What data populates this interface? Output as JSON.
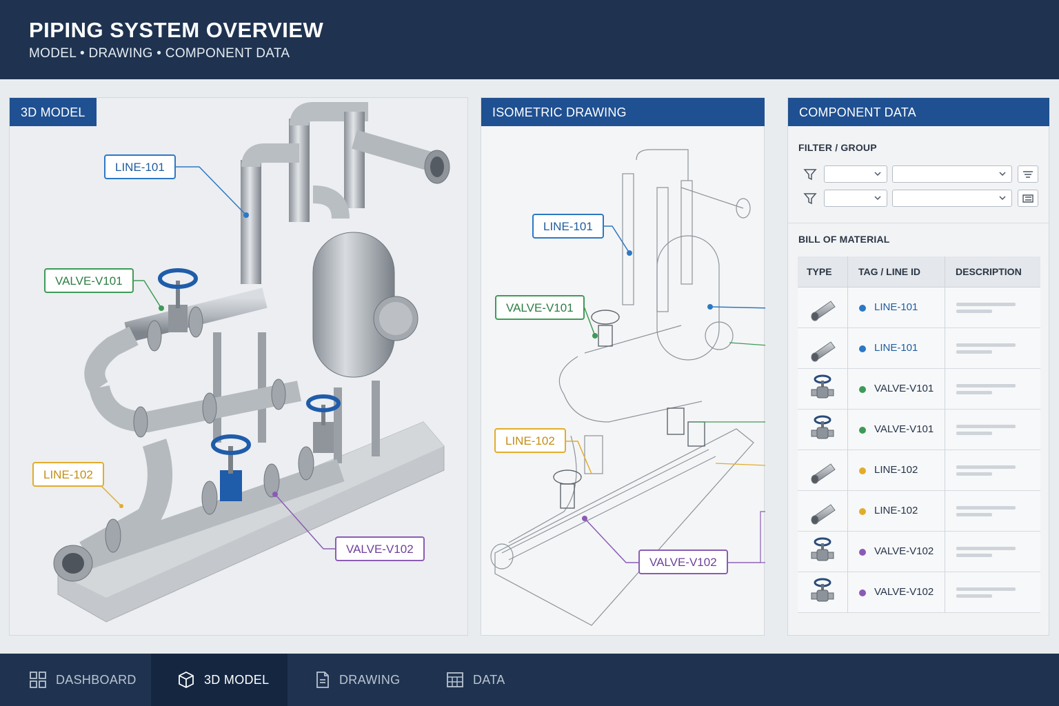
{
  "header": {
    "title": "PIPING SYSTEM OVERVIEW",
    "subtitle": "MODEL • DRAWING • COMPONENT DATA"
  },
  "model_panel": {
    "tab": "3D MODEL",
    "callouts": {
      "line101": "LINE-101",
      "valve101": "VALVE-V101",
      "line102": "LINE-102",
      "valve102": "VALVE-V102"
    }
  },
  "iso_panel": {
    "tab": "ISOMETRIC DRAWING",
    "callouts": {
      "line101": "LINE-101",
      "valve101": "VALVE-V101",
      "line102": "LINE-102",
      "valve102": "VALVE-V102"
    }
  },
  "data_panel": {
    "tab": "COMPONENT DATA",
    "filter_label": "FILTER / GROUP",
    "bom_label": "BILL OF MATERIAL",
    "columns": [
      "TYPE",
      "TAG / LINE ID",
      "DESCRIPTION"
    ],
    "rows": [
      {
        "type": "pipe",
        "tag": "LINE-101",
        "color": "#2c78c4"
      },
      {
        "type": "pipe",
        "tag": "LINE-101",
        "color": "#2c78c4"
      },
      {
        "type": "valve",
        "tag": "VALVE-V101",
        "color": "#3e9a57"
      },
      {
        "type": "valve",
        "tag": "VALVE-V101",
        "color": "#3e9a57"
      },
      {
        "type": "pipe",
        "tag": "LINE-102",
        "color": "#e2ac2b"
      },
      {
        "type": "pipe",
        "tag": "LINE-102",
        "color": "#e2ac2b"
      },
      {
        "type": "valve",
        "tag": "VALVE-V102",
        "color": "#8a5bb5"
      },
      {
        "type": "valve",
        "tag": "VALVE-V102",
        "color": "#8a5bb5"
      }
    ]
  },
  "nav": {
    "items": [
      {
        "label": "DASHBOARD",
        "icon": "dashboard-icon"
      },
      {
        "label": "3D MODEL",
        "icon": "cube-icon"
      },
      {
        "label": "DRAWING",
        "icon": "document-icon"
      },
      {
        "label": "DATA",
        "icon": "table-icon"
      }
    ],
    "active": "3D MODEL"
  },
  "colors": {
    "header_bg": "#1f3350",
    "tab_bg": "#1f5091",
    "line101": "#2c78c4",
    "valve101": "#3e9a57",
    "line102": "#e2ac2b",
    "valve102": "#8a5bb5"
  }
}
